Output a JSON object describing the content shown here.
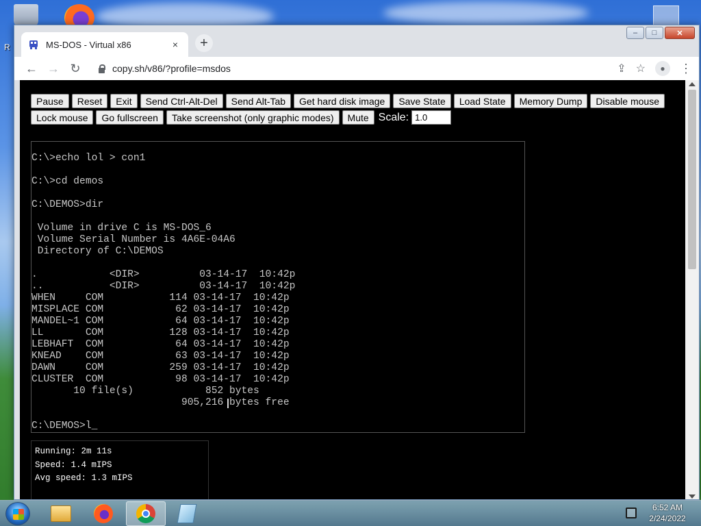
{
  "browser": {
    "tab_title": "MS-DOS - Virtual x86",
    "tab_close": "×",
    "new_tab": "+",
    "url": "copy.sh/v86/?profile=msdos",
    "window_buttons": {
      "minimize": "–",
      "maximize": "□",
      "close": "✕"
    }
  },
  "toolbar": {
    "back": "←",
    "forward": "→",
    "reload": "↻",
    "share": "⇪",
    "bookmark": "☆",
    "profile": "●",
    "menu": "⋮"
  },
  "controls": {
    "row1": [
      "Pause",
      "Reset",
      "Exit",
      "Send Ctrl-Alt-Del",
      "Send Alt-Tab",
      "Get hard disk image",
      "Save State",
      "Load State",
      "Memory Dump",
      "Disable mouse"
    ],
    "row2": [
      "Lock mouse",
      "Go fullscreen",
      "Take screenshot (only graphic modes)",
      "Mute"
    ],
    "scale_label": "Scale:",
    "scale_value": "1.0"
  },
  "terminal": {
    "lines": [
      "C:\\>echo lol > con1",
      "",
      "C:\\>cd demos",
      "",
      "C:\\DEMOS>dir",
      "",
      " Volume in drive C is MS-DOS_6",
      " Volume Serial Number is 4A6E-04A6",
      " Directory of C:\\DEMOS",
      "",
      ".            <DIR>          03-14-17  10:42p",
      "..           <DIR>          03-14-17  10:42p",
      "WHEN     COM           114 03-14-17  10:42p",
      "MISPLACE COM            62 03-14-17  10:42p",
      "MANDEL~1 COM            64 03-14-17  10:42p",
      "LL       COM           128 03-14-17  10:42p",
      "LEBHAFT  COM            64 03-14-17  10:42p",
      "KNEAD    COM            63 03-14-17  10:42p",
      "DAWN     COM           259 03-14-17  10:42p",
      "CLUSTER  COM            98 03-14-17  10:42p",
      "       10 file(s)            852 bytes",
      "                         905,216 bytes free",
      "",
      "C:\\DEMOS>l_"
    ]
  },
  "stats": {
    "running": "Running: 2m 11s",
    "speed": "Speed: 1.4 mIPS",
    "avg_speed": "Avg speed: 1.3 mIPS"
  },
  "taskbar": {
    "time": "6:52 AM",
    "date": "2/24/2022"
  },
  "desktop": {
    "partial_label": "R"
  },
  "icons": {
    "tab_favicon": "v86-icon",
    "lock": "lock-icon",
    "start": "windows-start-icon"
  }
}
